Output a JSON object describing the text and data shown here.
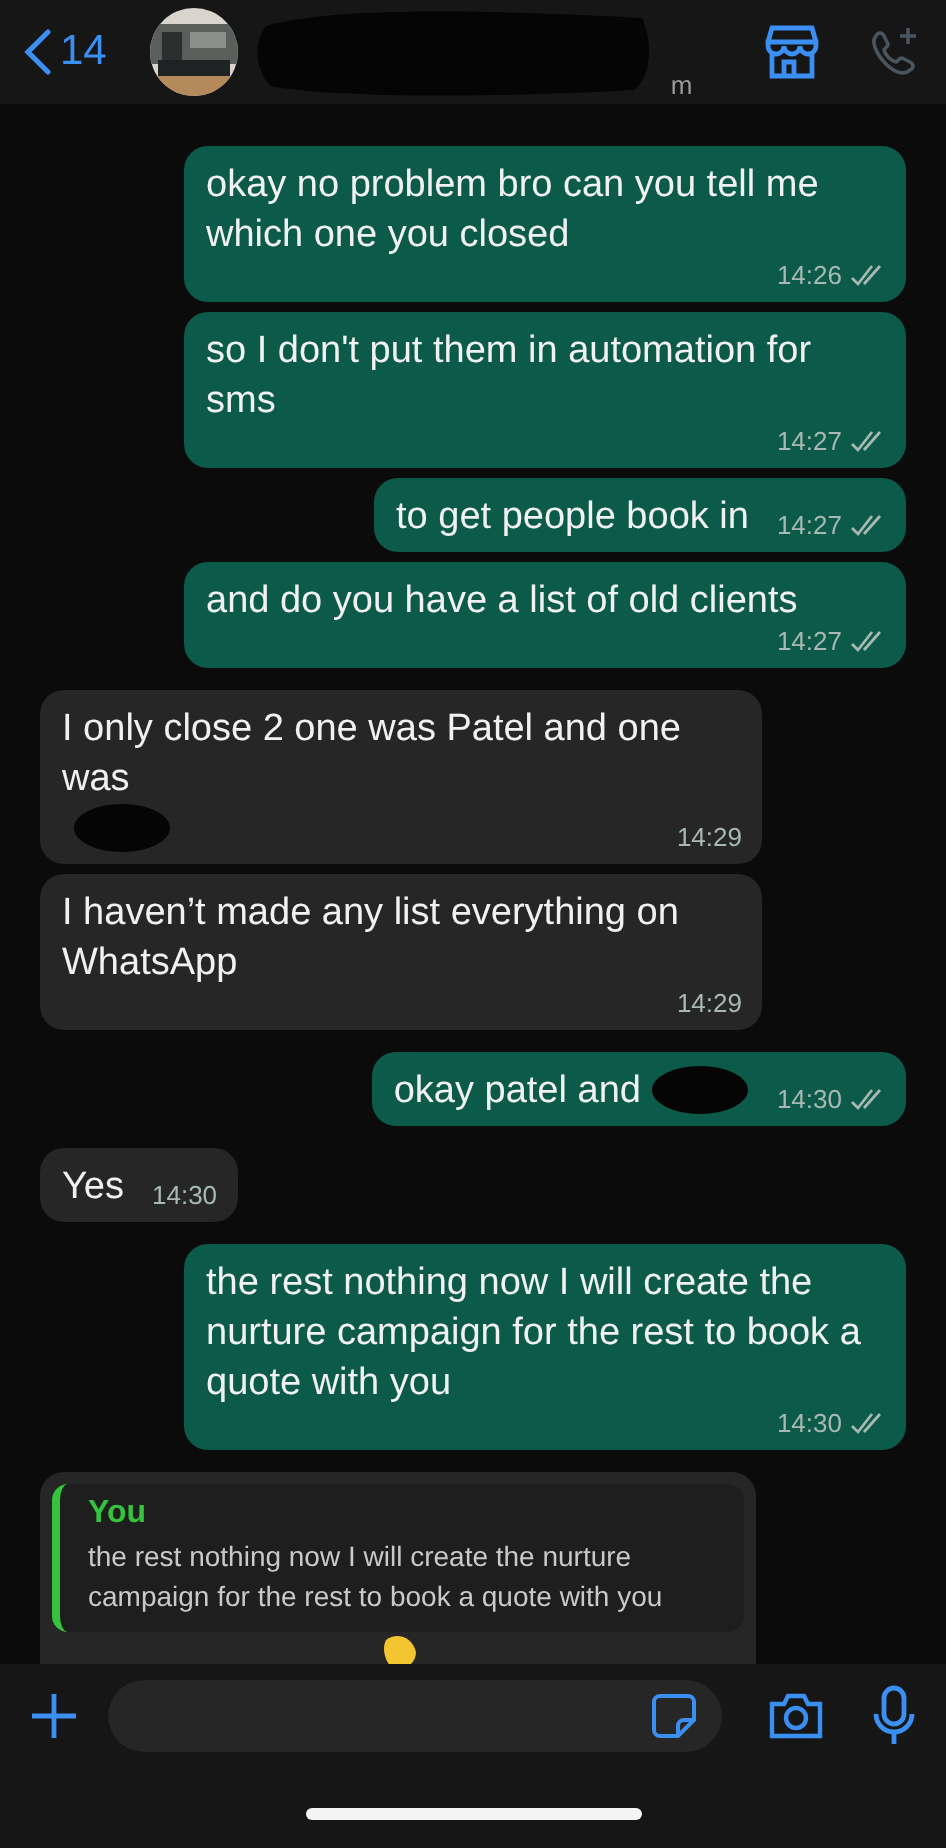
{
  "header": {
    "back_count": "14",
    "subtitle_fragment": "m",
    "call_disabled": true
  },
  "messages": [
    {
      "kind": "text",
      "outgoing": true,
      "parts": [
        {
          "text": "okay no problem bro can you tell me which one you closed"
        }
      ],
      "time": "14:26",
      "read": false
    },
    {
      "kind": "text",
      "outgoing": true,
      "parts": [
        {
          "text": "so I don't put them in automation for sms"
        }
      ],
      "time": "14:27",
      "read": false
    },
    {
      "kind": "text",
      "outgoing": true,
      "parts": [
        {
          "text": "to get people book in"
        }
      ],
      "time": "14:27",
      "read": false
    },
    {
      "kind": "text",
      "outgoing": true,
      "parts": [
        {
          "text": "and do you have a list of old clients"
        }
      ],
      "time": "14:27",
      "read": false
    },
    {
      "kind": "text",
      "outgoing": false,
      "parts": [
        {
          "text": "I only close 2 one was Patel and one was"
        },
        {
          "redacted": true
        }
      ],
      "time": "14:29"
    },
    {
      "kind": "text",
      "outgoing": false,
      "parts": [
        {
          "text": "I haven’t made any list everything on WhatsApp"
        }
      ],
      "time": "14:29"
    },
    {
      "kind": "text",
      "outgoing": true,
      "parts": [
        {
          "text": "okay patel and"
        },
        {
          "redacted": true
        }
      ],
      "time": "14:30",
      "read": false
    },
    {
      "kind": "text",
      "outgoing": false,
      "parts": [
        {
          "text": "Yes"
        }
      ],
      "time": "14:30"
    },
    {
      "kind": "text",
      "outgoing": true,
      "parts": [
        {
          "text": "the rest nothing now I will create the nurture campaign for the rest to book a quote with you"
        }
      ],
      "time": "14:30",
      "read": false
    },
    {
      "kind": "reply",
      "outgoing": false,
      "quote_author": "You",
      "quote_text": "the rest nothing now I will create the nurture campaign for the rest to book a quote with you"
    }
  ]
}
